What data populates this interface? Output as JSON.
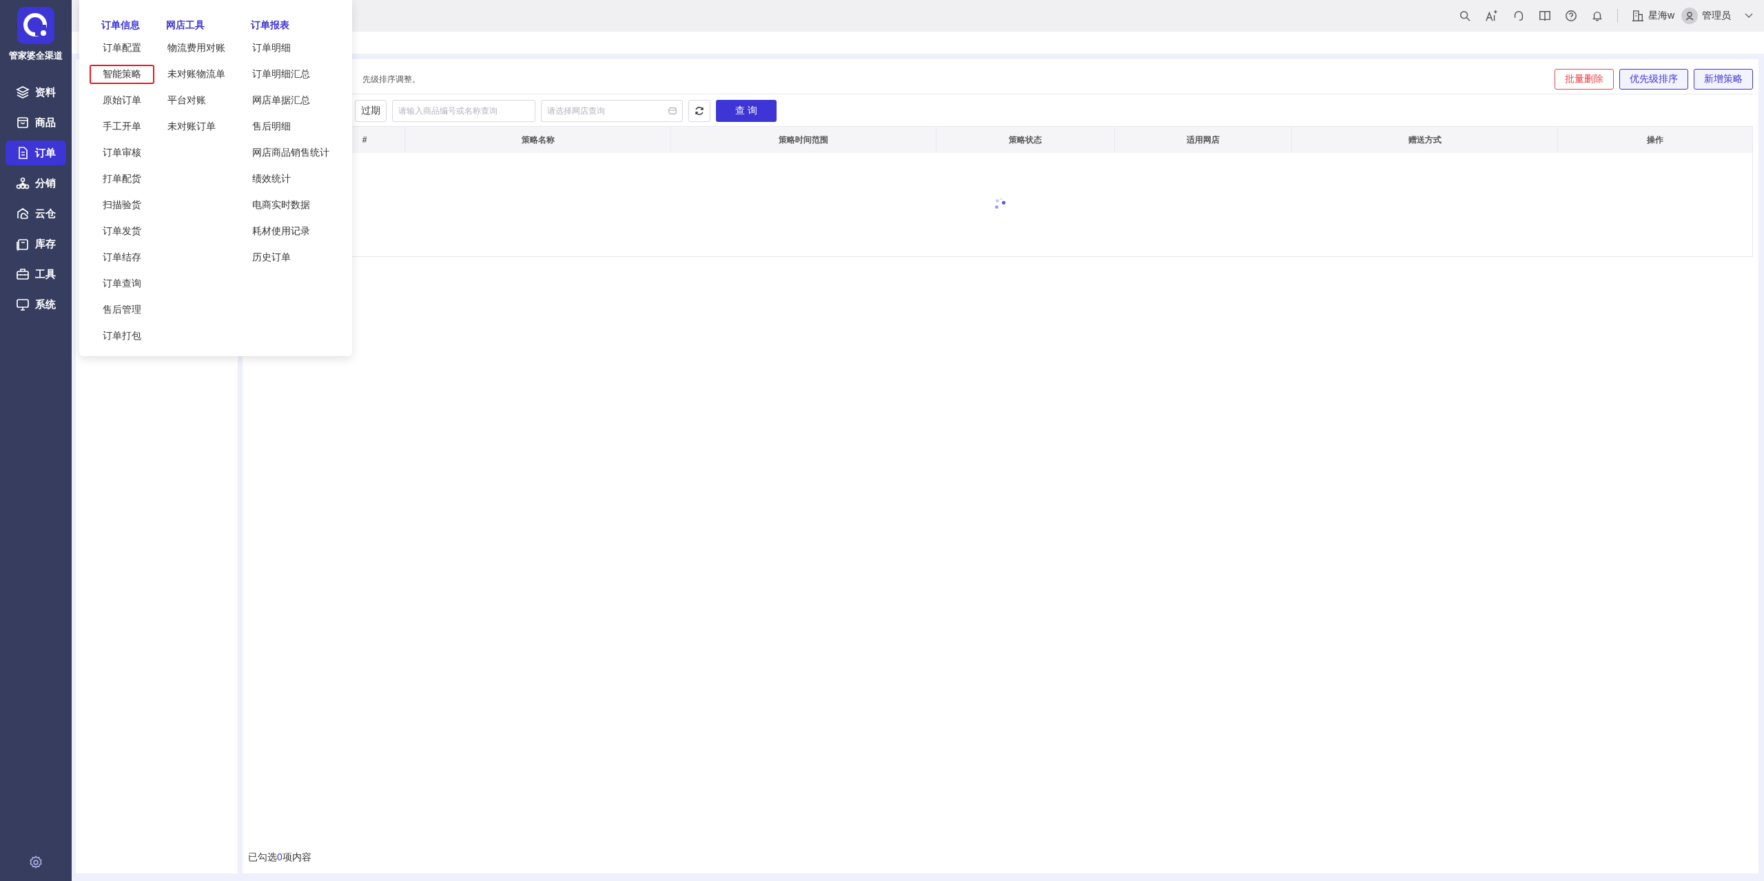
{
  "brand": {
    "name": "管家婆全渠道"
  },
  "nav": [
    {
      "label": "资料",
      "selected": false
    },
    {
      "label": "商品",
      "selected": false
    },
    {
      "label": "订单",
      "selected": true
    },
    {
      "label": "分销",
      "selected": false
    },
    {
      "label": "云仓",
      "selected": false
    },
    {
      "label": "库存",
      "selected": false
    },
    {
      "label": "工具",
      "selected": false
    },
    {
      "label": "系统",
      "selected": false
    }
  ],
  "header": {
    "store": "星海w",
    "user": "管理员"
  },
  "menu": [
    {
      "heading": "订单信息",
      "items": [
        {
          "label": "订单配置",
          "selected": false
        },
        {
          "label": "智能策略",
          "selected": true
        },
        {
          "label": "原始订单",
          "selected": false
        },
        {
          "label": "手工开单",
          "selected": false
        },
        {
          "label": "订单审核",
          "selected": false
        },
        {
          "label": "打单配货",
          "selected": false
        },
        {
          "label": "扫描验货",
          "selected": false
        },
        {
          "label": "订单发货",
          "selected": false
        },
        {
          "label": "订单结存",
          "selected": false
        },
        {
          "label": "订单查询",
          "selected": false
        },
        {
          "label": "售后管理",
          "selected": false
        },
        {
          "label": "订单打包",
          "selected": false
        }
      ]
    },
    {
      "heading": "网店工具",
      "items": [
        {
          "label": "物流费用对账",
          "selected": false
        },
        {
          "label": "未对账物流单",
          "selected": false
        },
        {
          "label": "平台对账",
          "selected": false
        },
        {
          "label": "未对账订单",
          "selected": false
        }
      ]
    },
    {
      "heading": "订单报表",
      "items": [
        {
          "label": "订单明细",
          "selected": false
        },
        {
          "label": "订单明细汇总",
          "selected": false
        },
        {
          "label": "网店单据汇总",
          "selected": false
        },
        {
          "label": "售后明细",
          "selected": false
        },
        {
          "label": "网店商品销售统计",
          "selected": false
        },
        {
          "label": "绩效统计",
          "selected": false
        },
        {
          "label": "电商实时数据",
          "selected": false
        },
        {
          "label": "耗材使用记录",
          "selected": false
        },
        {
          "label": "历史订单",
          "selected": false
        }
      ]
    }
  ],
  "description": "先级排序调整。",
  "actions": [
    {
      "label": "批量删除",
      "kind": "danger"
    },
    {
      "label": "优先级排序",
      "kind": "outline"
    },
    {
      "label": "新增策略",
      "kind": "outline"
    }
  ],
  "filters": {
    "status_button": "过期",
    "product_search": {
      "placeholder": "请输入商品编号或名称查询"
    },
    "store_select": {
      "placeholder": "请选择网店查询"
    },
    "query_button": "查 询"
  },
  "table": {
    "columns": [
      "#",
      "策略名称",
      "策略时间范围",
      "策略状态",
      "适用网店",
      "赠送方式",
      "操作"
    ],
    "loading": true
  },
  "selection_summary": {
    "prefix": "已勾选",
    "count": "0",
    "suffix": "项内容"
  }
}
